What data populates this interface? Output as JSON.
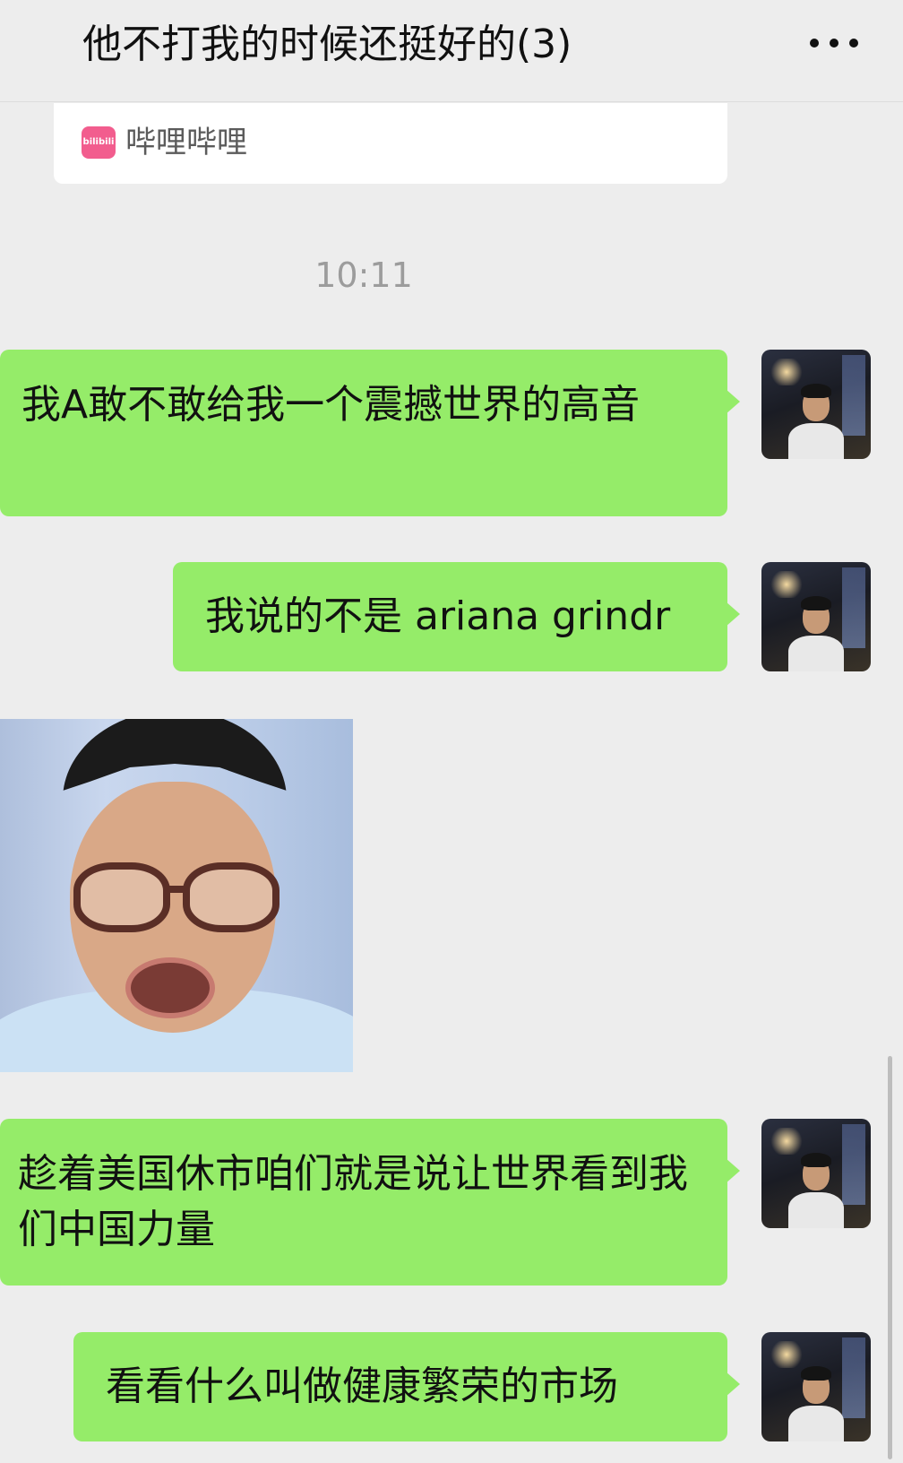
{
  "header": {
    "title": "他不打我的时候还挺好的(3)",
    "more_icon": "more-icon"
  },
  "shared_card": {
    "app_name": "哔哩哔哩",
    "icon_text": "bilibili"
  },
  "timestamp": "10:11",
  "messages": [
    {
      "text": "我A敢不敢给我一个震撼世界的高音"
    },
    {
      "text": "我说的不是 ariana grindr"
    },
    {
      "text": "趁着美国休市咱们就是说让世界看到我们中国力量"
    },
    {
      "text": "看看什么叫做健康繁荣的市场"
    }
  ],
  "colors": {
    "background": "#ededed",
    "bubble": "#95ec69",
    "bilibili": "#f25d8e"
  }
}
